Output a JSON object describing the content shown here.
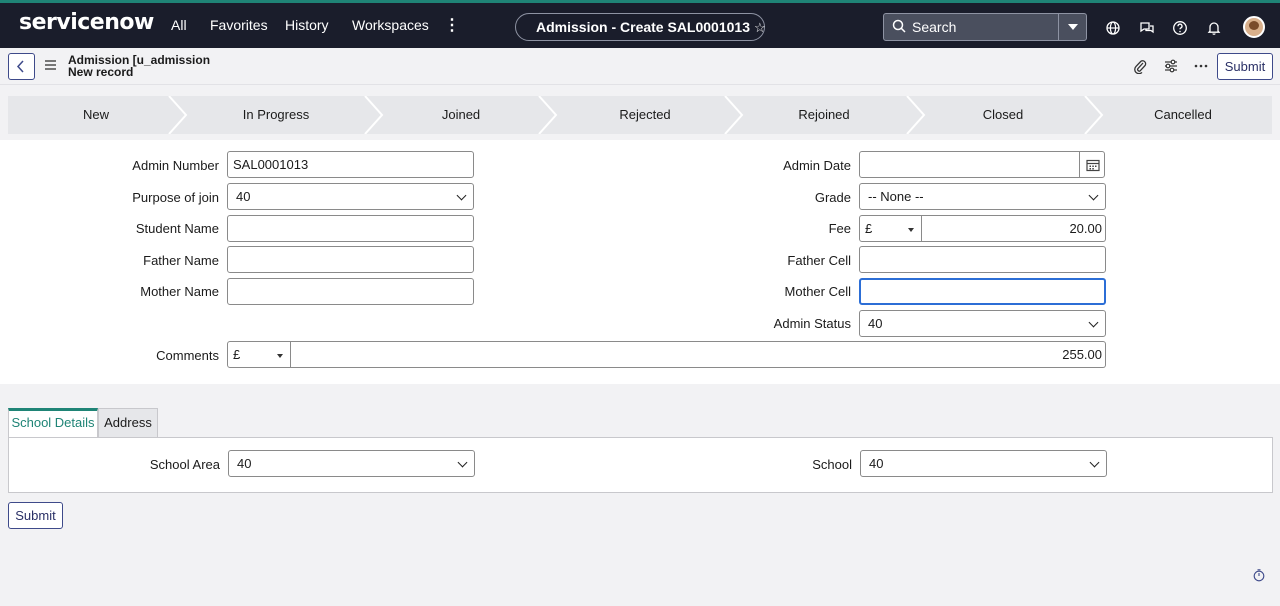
{
  "nav": {
    "logo": "servicenow",
    "links": [
      "All",
      "Favorites",
      "History",
      "Workspaces"
    ],
    "more": "⋮",
    "record_title": "Admission - Create SAL0001013",
    "search_placeholder": "Search"
  },
  "header": {
    "line1": "Admission [u_admission",
    "line2": "New record",
    "submit_label": "Submit"
  },
  "process_flow": [
    "New",
    "In Progress",
    "Joined",
    "Rejected",
    "Rejoined",
    "Closed",
    "Cancelled"
  ],
  "form": {
    "admin_number": {
      "label": "Admin Number",
      "value": "SAL0001013"
    },
    "purpose_of_join": {
      "label": "Purpose of join",
      "value": "40"
    },
    "student_name": {
      "label": "Student Name",
      "value": ""
    },
    "father_name": {
      "label": "Father Name",
      "value": ""
    },
    "mother_name": {
      "label": "Mother Name",
      "value": ""
    },
    "admin_date": {
      "label": "Admin Date",
      "value": ""
    },
    "grade": {
      "label": "Grade",
      "value": "-- None --"
    },
    "fee": {
      "label": "Fee",
      "currency": "£",
      "value": "20.00"
    },
    "father_cell": {
      "label": "Father Cell",
      "value": ""
    },
    "mother_cell": {
      "label": "Mother Cell",
      "value": ""
    },
    "admin_status": {
      "label": "Admin Status",
      "value": "40"
    },
    "comments": {
      "label": "Comments",
      "currency": "£",
      "value": "255.00"
    }
  },
  "tabs": [
    "School Details",
    "Address"
  ],
  "school_details": {
    "school_area": {
      "label": "School Area",
      "value": "40"
    },
    "school": {
      "label": "School",
      "value": "40"
    }
  },
  "footer": {
    "submit_label": "Submit"
  }
}
